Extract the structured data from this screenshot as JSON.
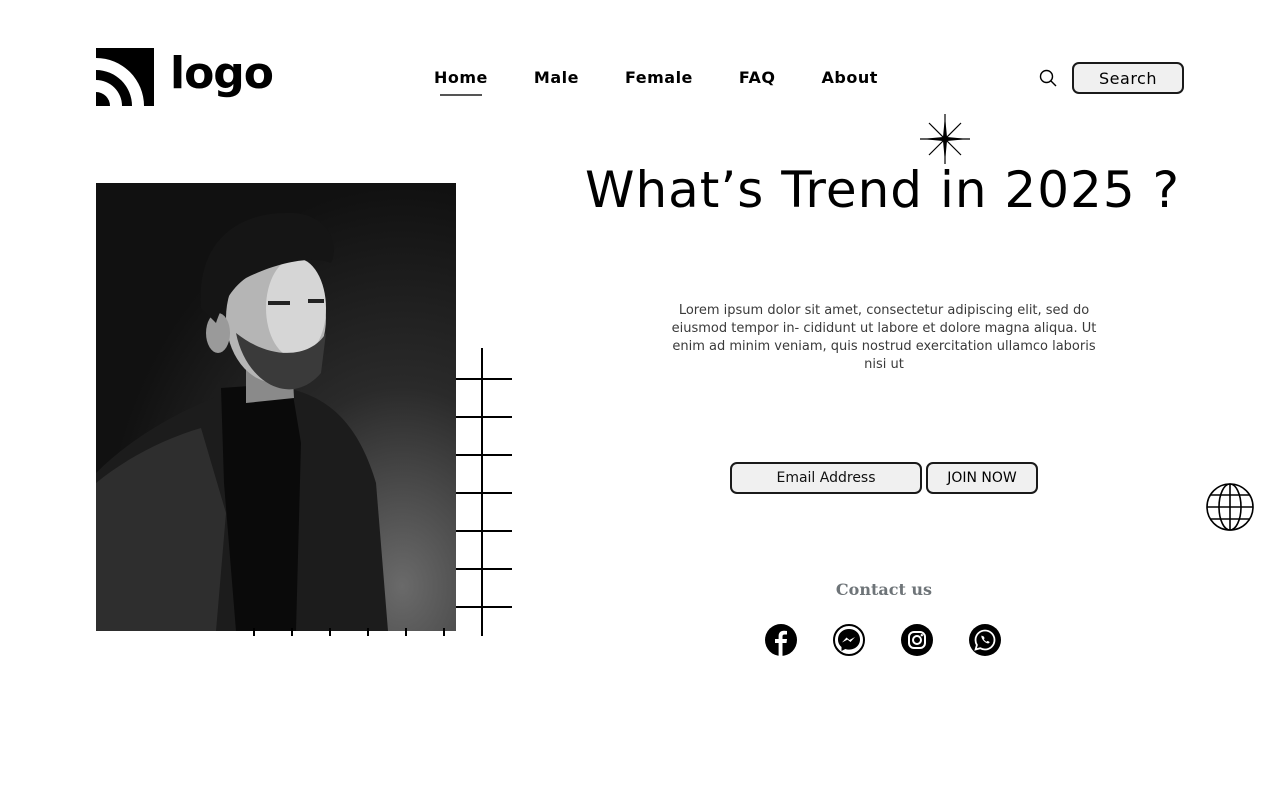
{
  "header": {
    "logo_text": "logo",
    "nav": [
      {
        "label": "Home",
        "active": true
      },
      {
        "label": "Male",
        "active": false
      },
      {
        "label": "Female",
        "active": false
      },
      {
        "label": "FAQ",
        "active": false
      },
      {
        "label": "About",
        "active": false
      }
    ],
    "search_label": "Search"
  },
  "hero": {
    "title": "What’s Trend in 2025 ?",
    "description": "Lorem ipsum dolor sit amet, consectetur adipiscing elit, sed do eiusmod tempor in- cididunt ut labore et dolore magna aliqua. Ut enim ad minim veniam, quis nostrud exercitation ullamco laboris nisi ut",
    "email_placeholder": "Email Address",
    "join_label": "JOIN NOW"
  },
  "contact": {
    "title": "Contact us",
    "socials": [
      "facebook-icon",
      "messenger-icon",
      "instagram-icon",
      "whatsapp-icon"
    ]
  },
  "icons": {
    "logo": "logo-mark-icon",
    "search": "search-icon",
    "star": "sparkle-icon",
    "globe": "globe-icon"
  }
}
